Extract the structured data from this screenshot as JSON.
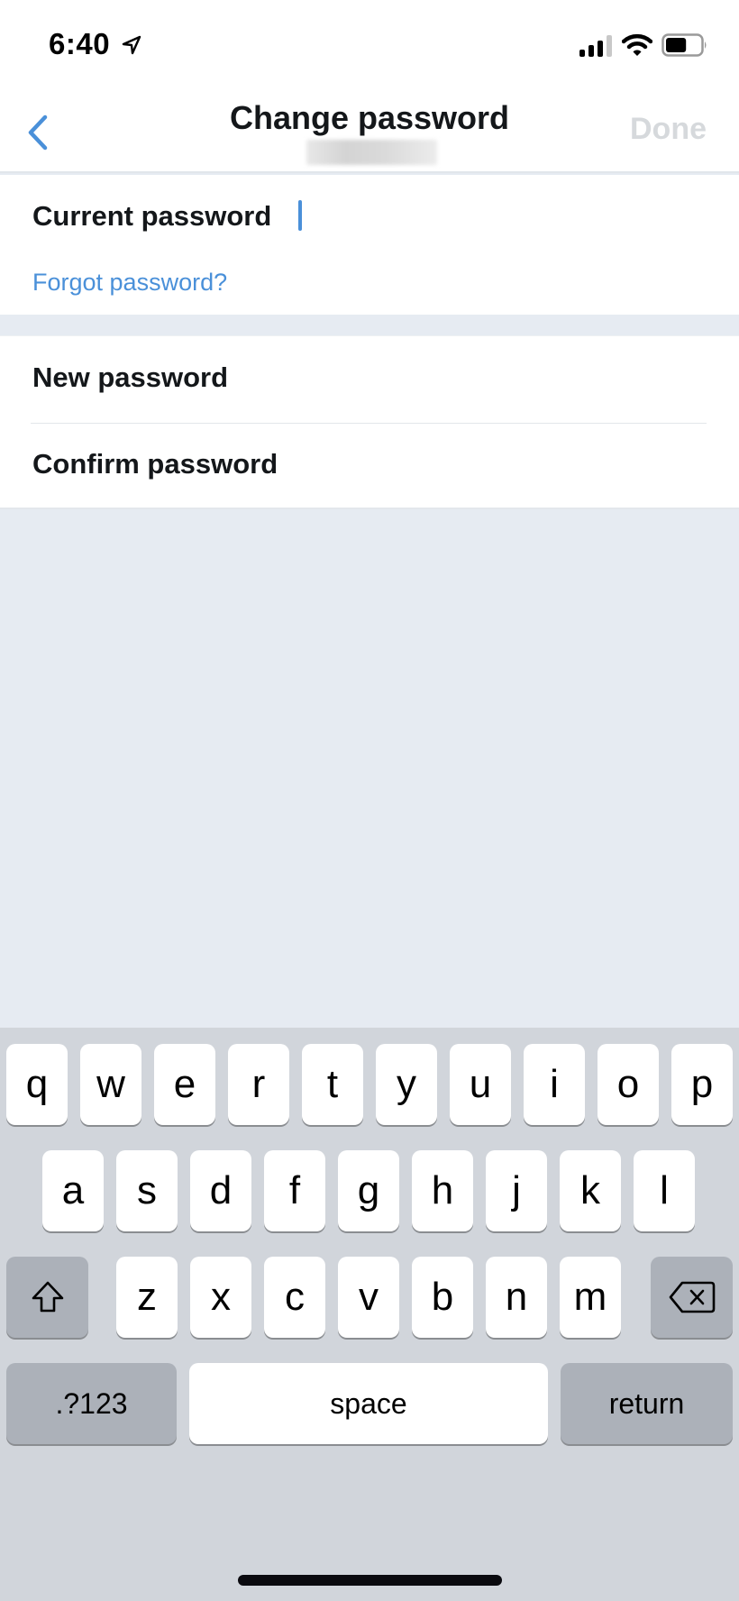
{
  "status_bar": {
    "time": "6:40",
    "location_icon": "location-arrow-icon",
    "signal_icon": "cellular-signal-icon",
    "signal_bars": 3,
    "signal_bars_total": 4,
    "wifi_icon": "wifi-icon",
    "battery_icon": "battery-icon",
    "battery_level": 0.6
  },
  "nav": {
    "back_icon": "chevron-left-icon",
    "title": "Change password",
    "done_label": "Done",
    "accent_color": "#4a90d9",
    "done_disabled_color": "#d6d9dc"
  },
  "form": {
    "current_password": {
      "label": "Current password",
      "value": ""
    },
    "forgot_link": "Forgot password?",
    "new_password": {
      "label": "New password",
      "value": ""
    },
    "confirm_password": {
      "label": "Confirm password",
      "value": ""
    }
  },
  "keyboard": {
    "row1": [
      "q",
      "w",
      "e",
      "r",
      "t",
      "y",
      "u",
      "i",
      "o",
      "p"
    ],
    "row2": [
      "a",
      "s",
      "d",
      "f",
      "g",
      "h",
      "j",
      "k",
      "l"
    ],
    "row3": [
      "z",
      "x",
      "c",
      "v",
      "b",
      "n",
      "m"
    ],
    "shift_icon": "shift-arrow-icon",
    "delete_icon": "backspace-icon",
    "numbers_label": ".?123",
    "space_label": "space",
    "return_label": "return"
  }
}
